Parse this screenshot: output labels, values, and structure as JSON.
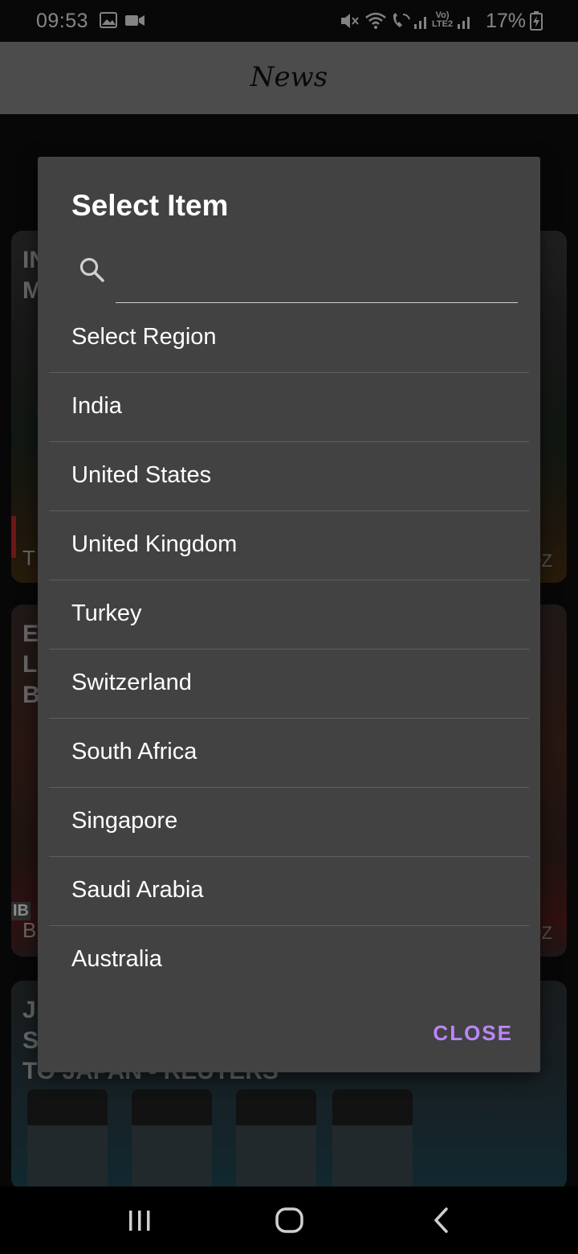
{
  "status_bar": {
    "time": "09:53",
    "battery_text": "17%",
    "icons": [
      "gallery-icon",
      "video-icon",
      "mute-icon",
      "wifi-icon",
      "wifi-call-icon",
      "signal-icon",
      "volte-icon",
      "signal-icon",
      "battery-charging-icon"
    ]
  },
  "app_bar": {
    "title": "News"
  },
  "dialog": {
    "title": "Select Item",
    "search_placeholder": "",
    "search_value": "",
    "items": [
      "Select Region",
      "India",
      "United States",
      "United Kingdom",
      "Turkey",
      "Switzerland",
      "South Africa",
      "Singapore",
      "Saudi Arabia",
      "Australia"
    ],
    "close_label": "CLOSE"
  },
  "colors": {
    "dialog_bg": "#424242",
    "accent": "#bb86fc",
    "app_bar_bg": "#8a8a8a",
    "divider": "#5e5e5e"
  }
}
